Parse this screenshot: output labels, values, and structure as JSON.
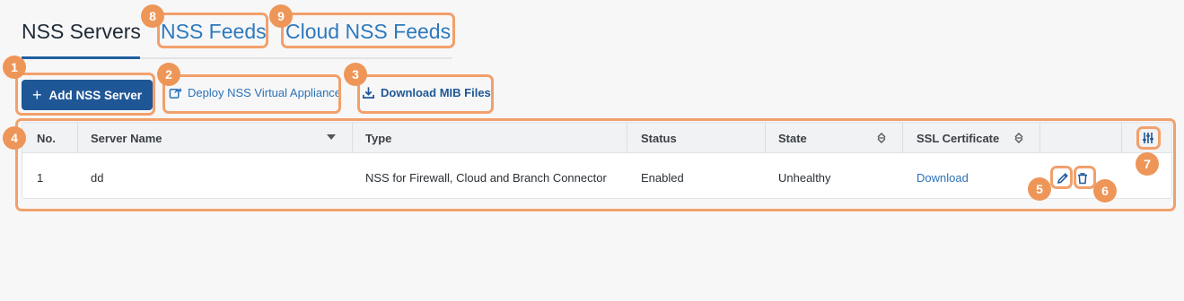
{
  "tabs": [
    {
      "label": "NSS Servers",
      "active": true
    },
    {
      "label": "NSS Feeds",
      "active": false
    },
    {
      "label": "Cloud NSS Feeds",
      "active": false
    }
  ],
  "toolbar": {
    "add_label": "Add NSS Server",
    "deploy_label": "Deploy NSS Virtual Appliance",
    "download_mib_label": "Download MIB Files"
  },
  "table": {
    "columns": [
      "No.",
      "Server Name",
      "Type",
      "Status",
      "State",
      "SSL Certificate"
    ],
    "rows": [
      {
        "no": "1",
        "server_name": "dd",
        "type": "NSS for Firewall, Cloud and Branch Connector",
        "status": "Enabled",
        "state": "Unhealthy",
        "ssl_certificate": "Download"
      }
    ]
  },
  "badges": [
    "1",
    "2",
    "3",
    "4",
    "5",
    "6",
    "7",
    "8",
    "9"
  ],
  "colors": {
    "primary": "#1f5796",
    "link": "#2a72b8",
    "highlight": "#f2a06b",
    "badge": "#ee9658"
  }
}
